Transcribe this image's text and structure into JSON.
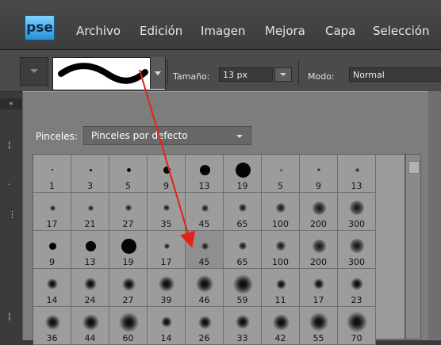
{
  "app": {
    "logo_text": "pse"
  },
  "menu": {
    "items": [
      "Archivo",
      "Edición",
      "Imagen",
      "Mejora",
      "Capa",
      "Selección"
    ]
  },
  "options_bar": {
    "size_label": "Tamaño:",
    "size_value": "13 px",
    "mode_label": "Modo:",
    "mode_value": "Normal"
  },
  "brush_picker": {
    "set_label": "Pinceles:",
    "set_value": "Pinceles por defecto",
    "rows": [
      [
        "1",
        "3",
        "5",
        "9",
        "13",
        "19",
        "5",
        "9",
        "13"
      ],
      [
        "17",
        "21",
        "27",
        "35",
        "45",
        "65",
        "100",
        "200",
        "300"
      ],
      [
        "9",
        "13",
        "19",
        "17",
        "45",
        "65",
        "100",
        "200",
        "300"
      ],
      [
        "14",
        "24",
        "27",
        "39",
        "46",
        "59",
        "11",
        "17",
        "23"
      ],
      [
        "36",
        "44",
        "60",
        "14",
        "26",
        "33",
        "42",
        "55",
        "70"
      ]
    ]
  },
  "colors": {
    "accent_arrow": "#e8201a",
    "logo": "#2a8fd6"
  },
  "icons": {
    "tool_dropdown": "chevron-down-icon",
    "collapse": "double-chevron-left-icon"
  }
}
